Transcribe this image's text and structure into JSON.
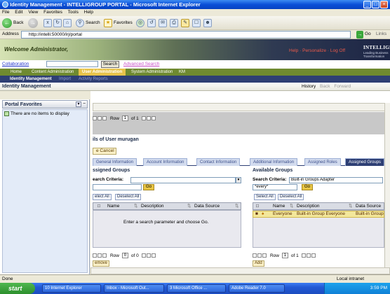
{
  "window": {
    "title": "Identity Management - INTELLIGROUP PORTAL - Microsoft Internet Explorer"
  },
  "menu": [
    "File",
    "Edit",
    "View",
    "Favorites",
    "Tools",
    "Help"
  ],
  "toolbar": {
    "back": "Back",
    "search": "Search",
    "favorites": "Favorites"
  },
  "address": {
    "label": "Address",
    "url": "http://intelli:50000/irj/portal",
    "go": "Go",
    "links": "Links"
  },
  "banner": {
    "welcome": "Welcome Administrator,",
    "links": "Help · Personalize · Log Off",
    "logo": "INTELLIGROUP",
    "logo_sub": "Leading Business Transformation"
  },
  "search": {
    "collaboration": "Collaboration",
    "button": "Search",
    "advanced": "Advanced Search"
  },
  "nav1": [
    "Home",
    "Content Administration",
    "User Administration",
    "System Administration",
    "KM"
  ],
  "nav2": [
    "Identity Management",
    "Import",
    "Activity Reports"
  ],
  "page": {
    "title": "Identity Management",
    "history": "History",
    "back": "Back",
    "forward": "Forward"
  },
  "favorites": {
    "title": "Portal Favorites",
    "empty": "There are no items to display"
  },
  "pager_top": {
    "row_label": "Row",
    "row": "1",
    "of": "of 1"
  },
  "details": {
    "title": "ils of User murugan",
    "cancel": "e Cancel"
  },
  "detail_tabs": [
    "General Information",
    "Account Information",
    "Contact Information",
    "Additional Information",
    "Assigned Roles",
    "Assigned Groups"
  ],
  "assigned": {
    "title": "ssigned Groups",
    "criteria_label": "earch Criteria:",
    "go": "Go",
    "select_all": "elect All",
    "deselect_all": "Deselect All",
    "columns": [
      "Name",
      "Description",
      "Data Source"
    ],
    "empty": "Enter a search parameter and choose Go.",
    "row_label": "Row",
    "row": "0",
    "of": "of 0",
    "action": "emove"
  },
  "available": {
    "title": "Available Groups",
    "criteria_label": "Search Criteria:",
    "criteria_value": "Built-in Groups Adapter",
    "query": "*every*",
    "go": "Go",
    "select_all": "Select All",
    "deselect_all": "Deselect All",
    "columns": [
      "Name",
      "Description",
      "Data Source"
    ],
    "rows": [
      {
        "name": "Everyone",
        "description": "Built-in Group Everyone",
        "source": "Built-in Group"
      }
    ],
    "row_label": "Row",
    "row": "1",
    "of": "of 1",
    "action": "Add"
  },
  "status": {
    "left": "Done",
    "zone": "Local intranet"
  },
  "taskbar": {
    "start": "start",
    "tasks": [
      "10 Internet Explorer",
      "Inbox - Microsoft Out...",
      "3 Microsoft Office ...",
      "Adobe Reader 7.0"
    ],
    "clock": "3:59 PM"
  }
}
